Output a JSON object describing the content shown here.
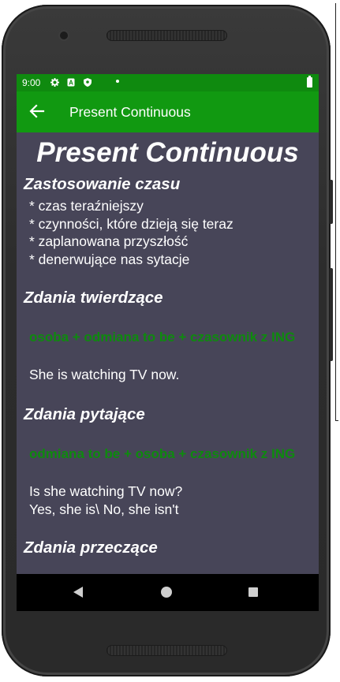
{
  "status_bar": {
    "time": "9:00",
    "icons": [
      "settings-icon",
      "notification-icon",
      "shield-icon",
      "dot-icon",
      "battery-icon"
    ]
  },
  "app_bar": {
    "back_icon": "arrow-back-icon",
    "title": "Present Continuous"
  },
  "content": {
    "title": "Present Continuous",
    "usage_heading": "Zastosowanie czasu",
    "usage_items": [
      "* czas teraźniejszy",
      "* czynności, które dzieją się teraz",
      "* zaplanowana przyszłość",
      "* denerwujące nas sytacje"
    ],
    "affirmative_heading": "Zdania twierdzące",
    "affirmative_formula": "osoba + odmiana to be + czasownik z ING",
    "affirmative_example": "She is watching TV now.",
    "question_heading": "Zdania pytające",
    "question_formula": "odmiana to be + osoba + czasownik z ING",
    "question_example_1": "Is she watching TV now?",
    "question_example_2": "Yes, she is\\ No, she isn't",
    "negative_heading": "Zdania przeczące"
  },
  "nav_bar": {
    "icons": [
      "nav-back-icon",
      "nav-home-icon",
      "nav-recents-icon"
    ]
  },
  "colors": {
    "status_bar": "#0f8a0f",
    "app_bar": "#119911",
    "screen_bg": "#474558",
    "formula": "#0e8a0e"
  }
}
